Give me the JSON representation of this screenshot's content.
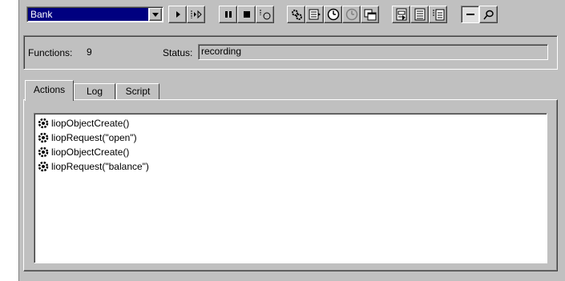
{
  "toolbar": {
    "combo_value": "Bank",
    "buttons": [
      {
        "name": "play-icon"
      },
      {
        "name": "step-icon"
      },
      {
        "name": "pause-icon"
      },
      {
        "name": "stop-icon"
      },
      {
        "name": "record-icon"
      },
      {
        "name": "gear-icon"
      },
      {
        "name": "list-icon"
      },
      {
        "name": "clock-icon"
      },
      {
        "name": "clock-disabled-icon"
      },
      {
        "name": "window-icon"
      },
      {
        "name": "document-icon"
      },
      {
        "name": "document-list-icon"
      },
      {
        "name": "document-step-icon"
      },
      {
        "name": "minimize-icon"
      },
      {
        "name": "pin-icon"
      }
    ]
  },
  "status": {
    "functions_label": "Functions:",
    "functions_value": "9",
    "status_label": "Status:",
    "status_value": "recording"
  },
  "tabs": [
    {
      "label": "Actions",
      "active": true
    },
    {
      "label": "Log",
      "active": false
    },
    {
      "label": "Script",
      "active": false
    }
  ],
  "actions": [
    {
      "text": "liopObjectCreate()",
      "icon": "gear-icon"
    },
    {
      "text": "liopRequest(\"open\")",
      "icon": "gear-icon"
    },
    {
      "text": "liopObjectCreate()",
      "icon": "gear-icon"
    },
    {
      "text": "liopRequest(\"balance\")",
      "icon": "gear-icon"
    }
  ]
}
